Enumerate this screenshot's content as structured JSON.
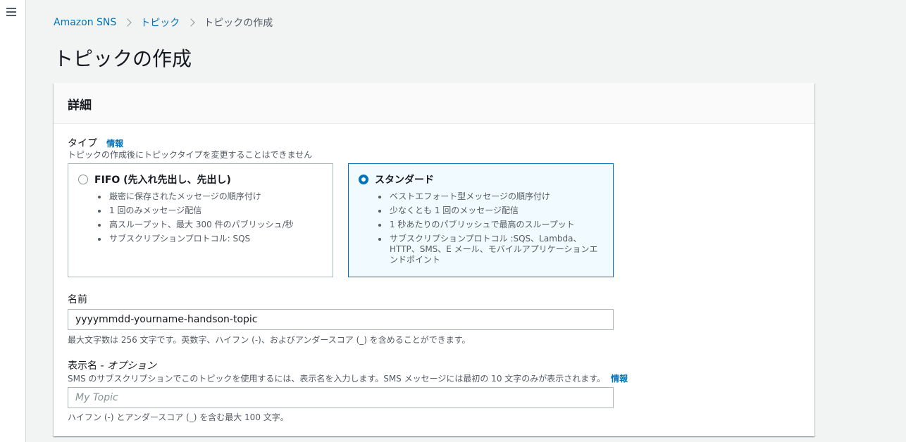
{
  "nav": {
    "menu_icon": "hamburger-menu-icon"
  },
  "breadcrumb": {
    "items": [
      "Amazon SNS",
      "トピック"
    ],
    "current": "トピックの作成"
  },
  "page": {
    "title": "トピックの作成"
  },
  "details": {
    "header": "詳細",
    "type": {
      "label": "タイプ",
      "info": "情報",
      "description": "トピックの作成後にトピックタイプを変更することはできません",
      "options": [
        {
          "title": "FIFO (先入れ先出し、先出し)",
          "selected": false,
          "bullets": [
            "厳密に保存されたメッセージの順序付け",
            "1 回のみメッセージ配信",
            "高スループット、最大 300 件のパブリッシュ/秒",
            "サブスクリプションプロトコル: SQS"
          ]
        },
        {
          "title": "スタンダード",
          "selected": true,
          "bullets": [
            "ベストエフォート型メッセージの順序付け",
            "少なくとも 1 回のメッセージ配信",
            "1 秒あたりのパブリッシュで最高のスループット",
            "サブスクリプションプロトコル :SQS、Lambda、HTTP、SMS、E メール、モバイルアプリケーションエンドポイント"
          ]
        }
      ]
    },
    "name": {
      "label": "名前",
      "value": "yyyymmdd-yourname-handson-topic",
      "constraint": "最大文字数は 256 文字です。英数字、ハイフン (-)、およびアンダースコア (_) を含めることができます。"
    },
    "display_name": {
      "label": "表示名 - ",
      "optional": "オプション",
      "description": "SMS のサブスクリプションでこのトピックを使用するには、表示名を入力します。SMS メッセージには最初の 10 文字のみが表示されます。",
      "info": "情報",
      "placeholder": "My Topic",
      "value": "",
      "constraint": "ハイフン (-) とアンダースコア (_) を含む最大 100 文字。"
    }
  },
  "colors": {
    "link": "#0073bb",
    "selected_border": "#0073bb",
    "selected_bg": "#f1faff",
    "page_bg": "#f2f3f3"
  }
}
